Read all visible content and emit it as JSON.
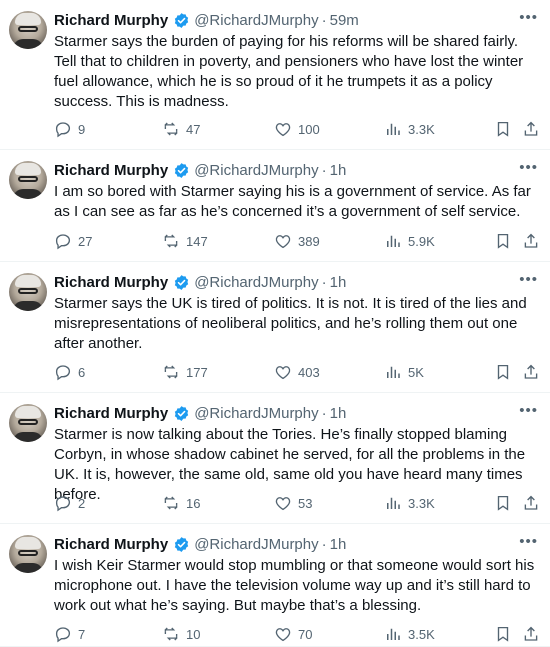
{
  "tweets": [
    {
      "name": "Richard Murphy",
      "handle": "@RichardJMurphy",
      "time": "59m",
      "text": "Starmer says the burden of paying for his reforms will be shared fairly. Tell that to children in poverty, and pensioners who have lost the winter fuel allowance, which he is so proud of it he trumpets it as a policy success. This is madness.",
      "replies": "9",
      "reposts": "47",
      "likes": "100",
      "views": "3.3K"
    },
    {
      "name": "Richard Murphy",
      "handle": "@RichardJMurphy",
      "time": "1h",
      "text": "I am so bored with Starmer saying his is a government of service. As far as I can see as far as he’s concerned it’s a government of self service.",
      "replies": "27",
      "reposts": "147",
      "likes": "389",
      "views": "5.9K"
    },
    {
      "name": "Richard Murphy",
      "handle": "@RichardJMurphy",
      "time": "1h",
      "text": "Starmer says the UK is tired of politics. It is not. It is tired of the lies and misrepresentations of neoliberal politics, and he’s rolling them out one after another.",
      "replies": "6",
      "reposts": "177",
      "likes": "403",
      "views": "5K"
    },
    {
      "name": "Richard Murphy",
      "handle": "@RichardJMurphy",
      "time": "1h",
      "text": "Starmer is now talking about the Tories. He’s finally stopped blaming Corbyn, in whose shadow cabinet he served, for all the problems in the UK. It is, however, the same old, same old you have heard many times before.",
      "replies": "2",
      "reposts": "16",
      "likes": "53",
      "views": "3.3K"
    },
    {
      "name": "Richard Murphy",
      "handle": "@RichardJMurphy",
      "time": "1h",
      "text": "I wish Keir Starmer would stop mumbling or that someone would sort his microphone out. I have the television volume way up and it’s still hard to work out what he’s saying. But maybe that’s a blessing.",
      "replies": "7",
      "reposts": "10",
      "likes": "70",
      "views": "3.5K"
    }
  ],
  "icons": {
    "verified": "verified-badge-icon",
    "more": "more-icon",
    "reply": "reply-icon",
    "repost": "repost-icon",
    "like": "like-icon",
    "views": "views-icon",
    "bookmark": "bookmark-icon",
    "share": "share-icon"
  },
  "colors": {
    "verified": "#1d9bf0",
    "muted": "#536471",
    "text": "#0f1419",
    "divider": "#eff3f4"
  }
}
